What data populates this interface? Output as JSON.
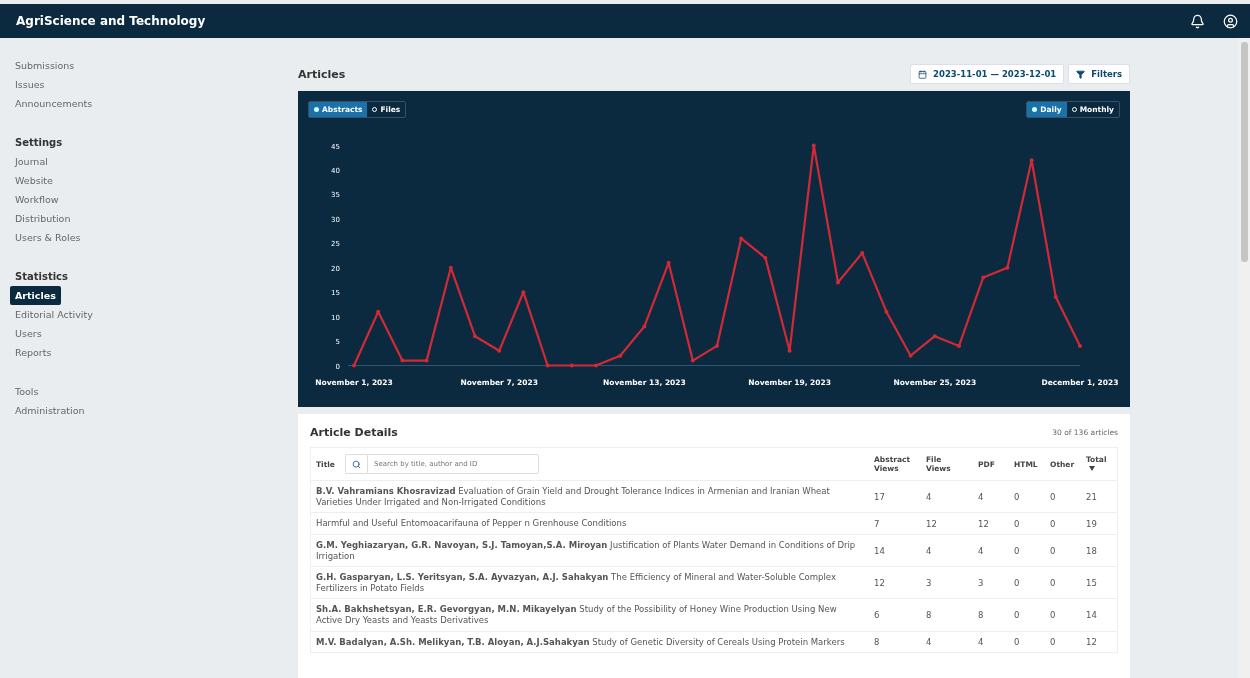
{
  "header": {
    "title": "AgriScience and Technology"
  },
  "sidebar": {
    "groups": [
      {
        "items": [
          {
            "label": "Submissions",
            "selected": false
          },
          {
            "label": "Issues",
            "selected": false
          },
          {
            "label": "Announcements",
            "selected": false
          }
        ]
      },
      {
        "heading": "Settings",
        "items": [
          {
            "label": "Journal",
            "selected": false
          },
          {
            "label": "Website",
            "selected": false
          },
          {
            "label": "Workflow",
            "selected": false
          },
          {
            "label": "Distribution",
            "selected": false
          },
          {
            "label": "Users & Roles",
            "selected": false
          }
        ]
      },
      {
        "heading": "Statistics",
        "items": [
          {
            "label": "Articles",
            "selected": true
          },
          {
            "label": "Editorial Activity",
            "selected": false
          },
          {
            "label": "Users",
            "selected": false
          },
          {
            "label": "Reports",
            "selected": false
          }
        ]
      },
      {
        "items": [
          {
            "label": "Tools",
            "selected": false
          },
          {
            "label": "Administration",
            "selected": false
          }
        ]
      }
    ]
  },
  "page": {
    "title": "Articles",
    "date_range": "2023-11-01 — 2023-12-01",
    "filters_label": "Filters"
  },
  "chart_panel": {
    "type_toggle": [
      {
        "label": "Abstracts",
        "selected": true
      },
      {
        "label": "Files",
        "selected": false
      }
    ],
    "period_toggle": [
      {
        "label": "Daily",
        "selected": true
      },
      {
        "label": "Monthly",
        "selected": false
      }
    ],
    "chart_data": {
      "type": "line",
      "ylim": [
        0,
        45
      ],
      "yticks": [
        0,
        5,
        10,
        15,
        20,
        25,
        30,
        35,
        40,
        45
      ],
      "categories": [
        "November 1, 2023",
        null,
        null,
        null,
        null,
        null,
        "November 7, 2023",
        null,
        null,
        null,
        null,
        null,
        "November 13, 2023",
        null,
        null,
        null,
        null,
        null,
        "November 19, 2023",
        null,
        null,
        null,
        null,
        null,
        "November 25, 2023",
        null,
        null,
        null,
        null,
        null,
        "December 1, 2023"
      ],
      "series": [
        {
          "color": "#d12a36",
          "values": [
            0,
            11,
            1,
            1,
            20,
            6,
            3,
            15,
            0,
            0,
            0,
            2,
            8,
            21,
            1,
            4,
            26,
            22,
            3,
            45,
            17,
            23,
            11,
            2,
            6,
            4,
            18,
            20,
            42,
            14,
            4
          ]
        }
      ]
    }
  },
  "details": {
    "title": "Article Details",
    "count": "30 of 136 articles",
    "search": {
      "label": "Title",
      "placeholder": "Search by title, author and ID"
    },
    "columns": [
      "Abstract Views",
      "File Views",
      "PDF",
      "HTML",
      "Other",
      "Total"
    ],
    "rows": [
      {
        "title": "**B.V. Vahramians Khosravizad** Evaluation of Grain Yield and Drought Tolerance Indices in Armenian and Iranian Wheat Varieties Under Irrigated and Non-Irrigated Conditions",
        "cells": [
          "17",
          "4",
          "4",
          "0",
          "0",
          "21"
        ]
      },
      {
        "title": "Harmful and Useful Entomoacarifauna of Pepper n Grenhouse Conditions",
        "cells": [
          "7",
          "12",
          "12",
          "0",
          "0",
          "19"
        ]
      },
      {
        "title": "**G.M. Yeghiazaryan, G.R. Navoyan, S.J. Tamoyan,S.A. Miroyan** Justification of Plants Water Demand in Conditions of Drip Irrigation",
        "cells": [
          "14",
          "4",
          "4",
          "0",
          "0",
          "18"
        ]
      },
      {
        "title": "**G.H. Gasparyan, L.S. Yeritsyan, S.A. Ayvazyan, A.J. Sahakyan** The Efficiency of Mineral and Water-Soluble Complex Fertilizers in Potato Fields",
        "cells": [
          "12",
          "3",
          "3",
          "0",
          "0",
          "15"
        ]
      },
      {
        "title": "**Sh.A. Bakhshetsyan, E.R. Gevorgyan, M.N. Mikayelyan** Study of the Possibility of Honey Wine Production Using New Active Dry Yeasts and Yeasts Derivatives",
        "cells": [
          "6",
          "8",
          "8",
          "0",
          "0",
          "14"
        ]
      },
      {
        "title": "**M.V. Badalyan, A.Sh. Melikyan, T.B. Aloyan, A.J.Sahakyan** Study of Genetic Diversity of Cereals Using Protein Markers",
        "cells": [
          "8",
          "4",
          "4",
          "0",
          "0",
          "12"
        ]
      }
    ]
  }
}
